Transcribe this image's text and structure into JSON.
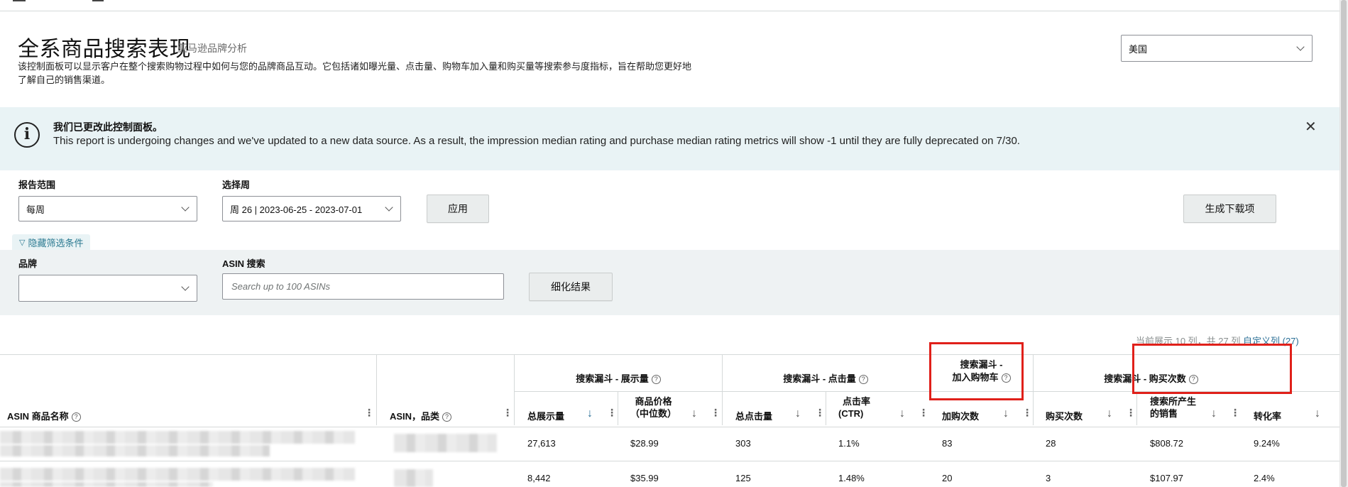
{
  "header": {
    "title": "全系商品搜索表现",
    "subtitle": "亚马逊品牌分析",
    "description": "该控制面板可以显示客户在整个搜索购物过程中如何与您的品牌商品互动。它包括诸如曝光量、点击量、购物车加入量和购买量等搜索参与度指标，旨在帮助您更好地了解自己的销售渠道。",
    "country": "美国"
  },
  "banner": {
    "title": "我们已更改此控制面板。",
    "message": "This report is undergoing changes and we've updated to a new data source. As a result, the impression median rating and purchase median rating metrics will show -1 until they are fully deprecated on 7/30."
  },
  "filters": {
    "report_range_label": "报告范围",
    "report_range_value": "每周",
    "week_label": "选择周",
    "week_value": "周 26 | 2023-06-25 - 2023-07-01",
    "apply_label": "应用",
    "generate_label": "生成下载项",
    "hide_filters_label": "隐藏筛选条件",
    "brand_label": "品牌",
    "brand_value": "",
    "asin_search_label": "ASIN 搜索",
    "asin_search_placeholder": "Search up to 100 ASINs",
    "refine_label": "细化结果"
  },
  "column_info": {
    "text": "当前展示 10 列，共 27 列",
    "link": "自定义列 (27)"
  },
  "table": {
    "group_headers": {
      "impressions": "搜索漏斗 - 展示量",
      "clicks": "搜索漏斗 - 点击量",
      "cart_line1": "搜索漏斗 -",
      "cart_line2": "加入购物车",
      "purchases": "搜索漏斗 - 购买次数"
    },
    "columns": {
      "asin_name": "ASIN 商品名称",
      "asin_category": "ASIN，品类",
      "total_impressions": "总展示量",
      "price_line1": "商品价格",
      "price_line2": "（中位数）",
      "total_clicks": "总点击量",
      "ctr_line1": "点击率",
      "ctr_line2": "(CTR)",
      "cart_adds": "加购次数",
      "purchases": "购买次数",
      "sales_line1": "搜索所产生",
      "sales_line2": "的销售",
      "conversion": "转化率"
    },
    "rows": [
      {
        "impressions": "27,613",
        "price": "$28.99",
        "clicks": "303",
        "ctr": "1.1%",
        "cart": "83",
        "purchases": "28",
        "sales": "$808.72",
        "conversion": "9.24%"
      },
      {
        "impressions": "8,442",
        "price": "$35.99",
        "clicks": "125",
        "ctr": "1.48%",
        "cart": "20",
        "purchases": "3",
        "sales": "$107.97",
        "conversion": "2.4%"
      }
    ]
  },
  "icons": {
    "info": "info-circle-icon",
    "close": "close-icon",
    "help": "question-circle-icon",
    "sort": "arrow-down-icon",
    "menu": "kebab-menu-icon",
    "filter": "funnel-icon",
    "dropdown": "chevron-down-icon"
  },
  "colors": {
    "banner_bg": "#e9f3f5",
    "link": "#2b6f96",
    "highlight": "#e0201a"
  }
}
